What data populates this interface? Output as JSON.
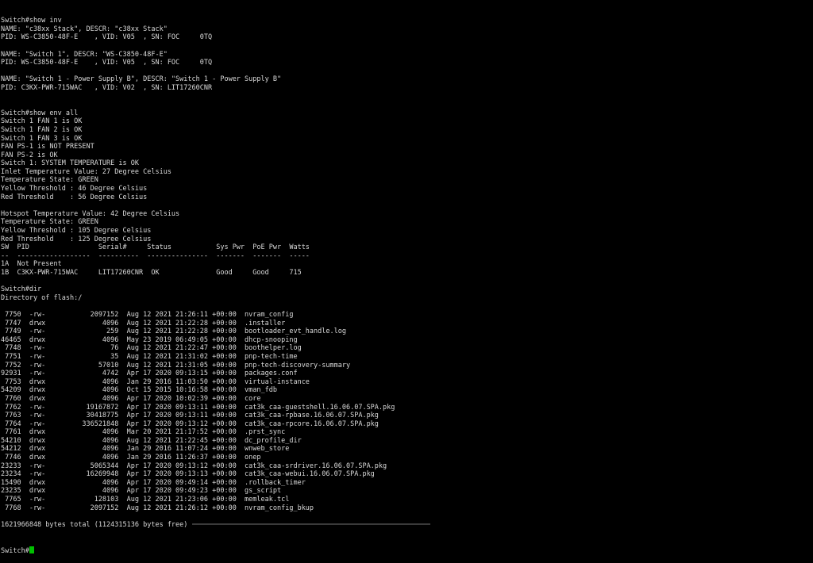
{
  "terminal": {
    "lines": [
      "Switch#show inv",
      "NAME: \"c38xx Stack\", DESCR: \"c38xx Stack\"",
      "PID: WS-C3850-48F-E    , VID: V05  , SN: FOC     0TQ",
      "",
      "NAME: \"Switch 1\", DESCR: \"WS-C3850-48F-E\"",
      "PID: WS-C3850-48F-E    , VID: V05  , SN: FOC     0TQ",
      "",
      "NAME: \"Switch 1 - Power Supply B\", DESCR: \"Switch 1 - Power Supply B\"",
      "PID: C3KX-PWR-715WAC   , VID: V02  , SN: LIT17260CNR",
      "",
      "",
      "Switch#show env all",
      "Switch 1 FAN 1 is OK",
      "Switch 1 FAN 2 is OK",
      "Switch 1 FAN 3 is OK",
      "FAN PS-1 is NOT PRESENT",
      "FAN PS-2 is OK",
      "Switch 1: SYSTEM TEMPERATURE is OK",
      "Inlet Temperature Value: 27 Degree Celsius",
      "Temperature State: GREEN",
      "Yellow Threshold : 46 Degree Celsius",
      "Red Threshold    : 56 Degree Celsius",
      "",
      "Hotspot Temperature Value: 42 Degree Celsius",
      "Temperature State: GREEN",
      "Yellow Threshold : 105 Degree Celsius",
      "Red Threshold    : 125 Degree Celsius",
      "SW  PID                 Serial#     Status           Sys Pwr  PoE Pwr  Watts",
      "--  ------------------  ----------  ---------------  -------  -------  -----",
      "1A  Not Present",
      "1B  C3KX-PWR-715WAC     LIT17260CNR  OK              Good     Good     715",
      "",
      "Switch#dir",
      "Directory of flash:/",
      "",
      " 7750  -rw-           2097152  Aug 12 2021 21:26:11 +00:00  nvram_config",
      " 7747  drwx              4096  Aug 12 2021 21:22:28 +00:00  .installer",
      " 7749  -rw-               259  Aug 12 2021 21:22:28 +00:00  bootloader_evt_handle.log",
      "46465  drwx              4096  May 23 2019 06:49:05 +00:00  dhcp-snooping",
      " 7748  -rw-                76  Aug 12 2021 21:22:47 +00:00  boothelper.log",
      " 7751  -rw-                35  Aug 12 2021 21:31:02 +00:00  pnp-tech-time",
      " 7752  -rw-             57010  Aug 12 2021 21:31:05 +00:00  pnp-tech-discovery-summary",
      "92931  -rw-              4742  Apr 17 2020 09:13:15 +00:00  packages.conf",
      " 7753  drwx              4096  Jan 29 2016 11:03:50 +00:00  virtual-instance",
      "54209  drwx              4096  Oct 15 2015 10:16:58 +00:00  vman_fdb",
      " 7760  drwx              4096  Apr 17 2020 10:02:39 +00:00  core",
      " 7762  -rw-          19167872  Apr 17 2020 09:13:11 +00:00  cat3k_caa-guestshell.16.06.07.SPA.pkg",
      " 7763  -rw-          30418775  Apr 17 2020 09:13:11 +00:00  cat3k_caa-rpbase.16.06.07.SPA.pkg",
      " 7764  -rw-         336521848  Apr 17 2020 09:13:12 +00:00  cat3k_caa-rpcore.16.06.07.SPA.pkg",
      " 7761  drwx              4096  Mar 20 2021 21:17:52 +00:00  .prst_sync",
      "54210  drwx              4096  Aug 12 2021 21:22:45 +00:00  dc_profile_dir",
      "54212  drwx              4096  Jan 29 2016 11:07:24 +00:00  wnweb_store",
      " 7746  drwx              4096  Jan 29 2016 11:26:37 +00:00  onep",
      "23233  -rw-           5065344  Apr 17 2020 09:13:12 +00:00  cat3k_caa-srdriver.16.06.07.SPA.pkg",
      "23234  -rw-          16269948  Apr 17 2020 09:13:13 +00:00  cat3k_caa-webui.16.06.07.SPA.pkg",
      "15490  drwx              4096  Apr 17 2020 09:49:14 +00:00  .rollback_timer",
      "23235  drwx              4096  Apr 17 2020 09:49:23 +00:00  gs_script",
      " 7765  -rw-            128103  Aug 12 2021 21:23:06 +00:00  memleak.tcl",
      " 7768  -rw-           2097152  Aug 12 2021 21:26:12 +00:00  nvram_config_bkup",
      "",
      "1621966848 bytes total (1124315136 bytes free)"
    ],
    "prompt": "Switch#",
    "cursor_color": "#00c000",
    "text_color": "#d9d9d9",
    "background_color": "#000000"
  }
}
